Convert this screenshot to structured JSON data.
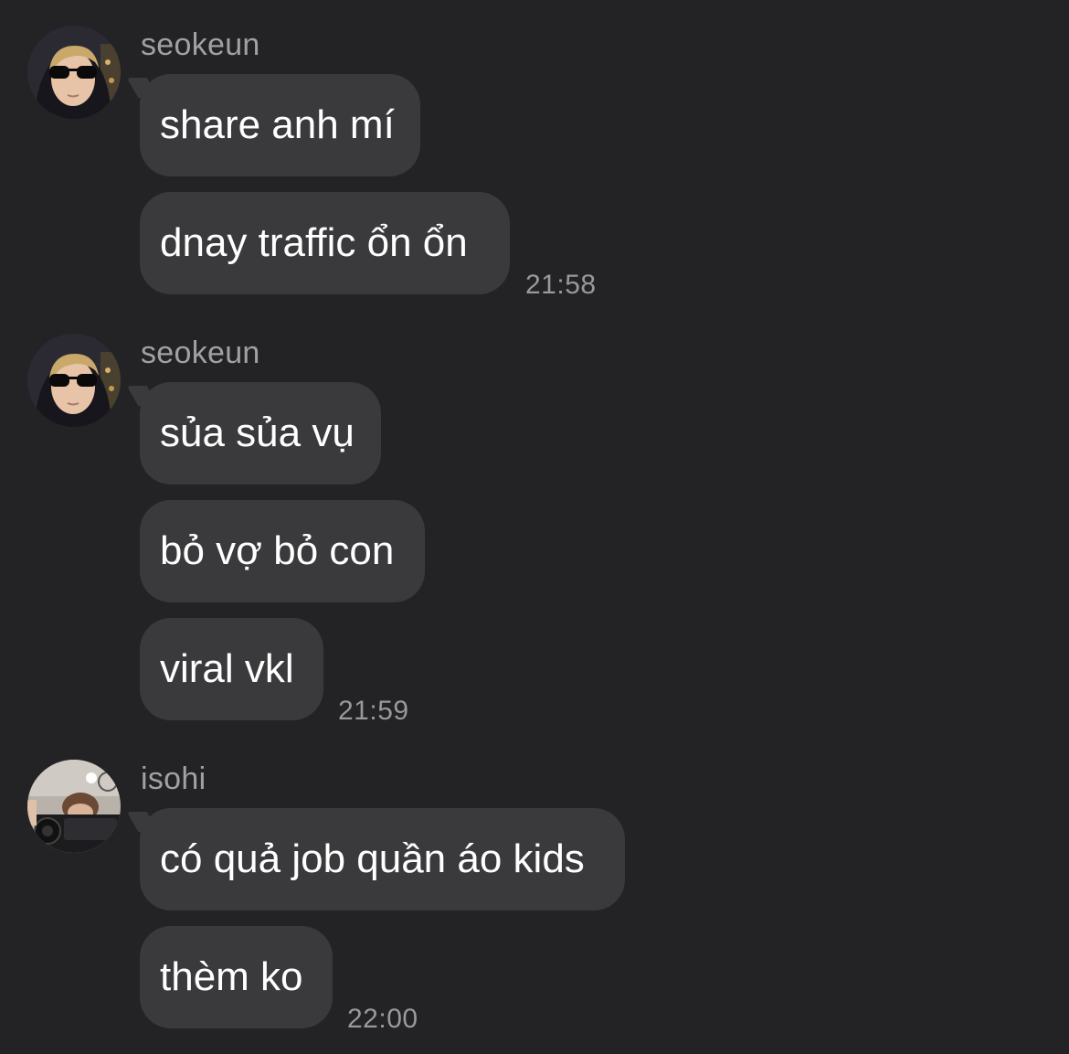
{
  "groups": [
    {
      "sender": "seokeun",
      "avatar": "avatar-sunglasses-hood",
      "messages": [
        "share anh mí",
        "dnay traffic ổn ổn"
      ],
      "time": "21:58"
    },
    {
      "sender": "seokeun",
      "avatar": "avatar-sunglasses-hood",
      "messages": [
        "sủa sủa vụ",
        "bỏ vợ bỏ con",
        "viral vkl"
      ],
      "time": "21:59"
    },
    {
      "sender": "isohi",
      "avatar": "avatar-camera",
      "messages": [
        "có quả job quần áo kids",
        "thèm ko"
      ],
      "time": "22:00"
    }
  ],
  "colors": {
    "background": "#232325",
    "bubble": "#3a3a3c",
    "message_text": "#ffffff",
    "meta_text": "#98989d"
  }
}
